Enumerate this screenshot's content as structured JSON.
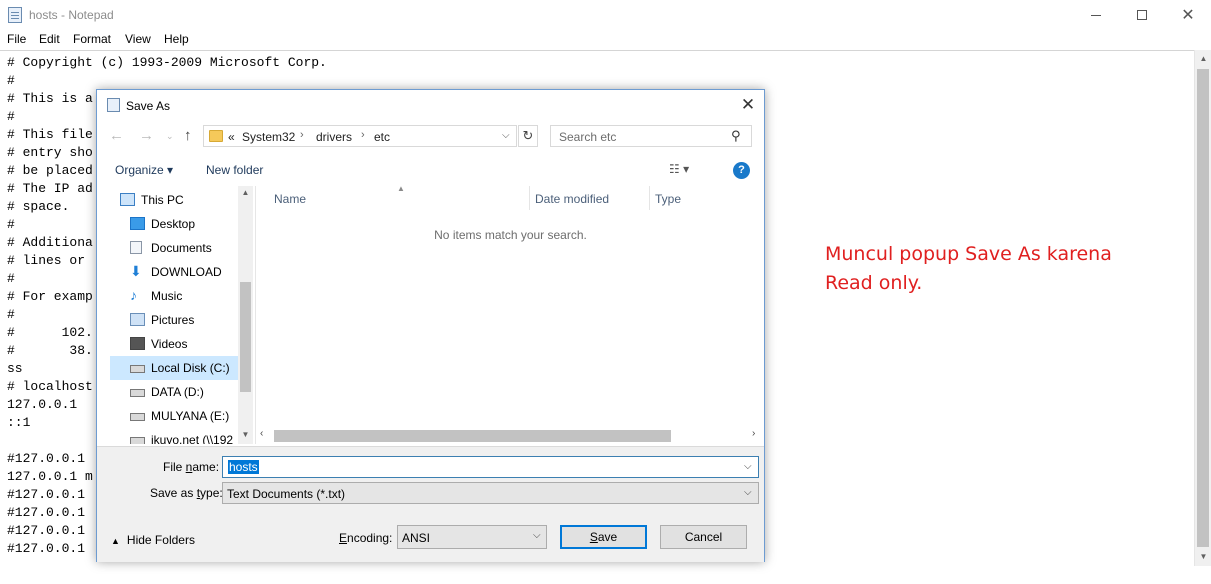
{
  "notepad": {
    "title": "hosts - Notepad",
    "menu": [
      "File",
      "Edit",
      "Format",
      "View",
      "Help"
    ],
    "lines": [
      "# Copyright (c) 1993-2009 Microsoft Corp.",
      "#",
      "# This is a",
      "#",
      "# This file",
      "# entry sho",
      "# be placed",
      "# The IP ad",
      "# space.",
      "#",
      "# Additiona",
      "# lines or",
      "#",
      "# For examp",
      "#",
      "#      102.",
      "#       38.",
      "ss",
      "# localhost",
      "127.0.0.1",
      "::1",
      "",
      "#127.0.0.1",
      "127.0.0.1 m",
      "#127.0.0.1",
      "#127.0.0.1",
      "#127.0.0.1",
      "#127.0.0.1"
    ]
  },
  "annotation": "Muncul popup Save As karena\nRead only.",
  "dialog": {
    "title": "Save As",
    "close": "✕",
    "address": {
      "prefix": "«",
      "crumbs": [
        "System32",
        "drivers",
        "etc"
      ]
    },
    "search_placeholder": "Search etc",
    "organize": "Organize ▾",
    "new_folder": "New folder",
    "help": "?",
    "nav_items": [
      {
        "label": "This PC",
        "icon": "computer-icon"
      },
      {
        "label": "Desktop",
        "icon": "desktop-icon"
      },
      {
        "label": "Documents",
        "icon": "documents-icon"
      },
      {
        "label": "DOWNLOAD",
        "icon": "download-icon"
      },
      {
        "label": "Music",
        "icon": "music-icon"
      },
      {
        "label": "Pictures",
        "icon": "pictures-icon"
      },
      {
        "label": "Videos",
        "icon": "videos-icon"
      },
      {
        "label": "Local Disk (C:)",
        "icon": "drive-icon",
        "selected": true
      },
      {
        "label": "DATA (D:)",
        "icon": "drive-icon"
      },
      {
        "label": "MULYANA (E:)",
        "icon": "drive-icon"
      },
      {
        "label": "ikuyo.net (\\\\192",
        "icon": "network-drive-icon"
      }
    ],
    "columns": [
      "Name",
      "Date modified",
      "Type"
    ],
    "empty_message": "No items match your search.",
    "file_name_label_pre": "File ",
    "file_name_label_u": "n",
    "file_name_label_post": "ame:",
    "file_name": "hosts",
    "save_type_label_pre": "Save as ",
    "save_type_label_u": "t",
    "save_type_label_post": "ype:",
    "save_type": "Text Documents (*.txt)",
    "hide_folders": "Hide Folders",
    "encoding_label_pre": "",
    "encoding_label_u": "E",
    "encoding_label_post": "ncoding:",
    "encoding": "ANSI",
    "save_label_u": "S",
    "save_label_post": "ave",
    "cancel_label": "Cancel"
  }
}
